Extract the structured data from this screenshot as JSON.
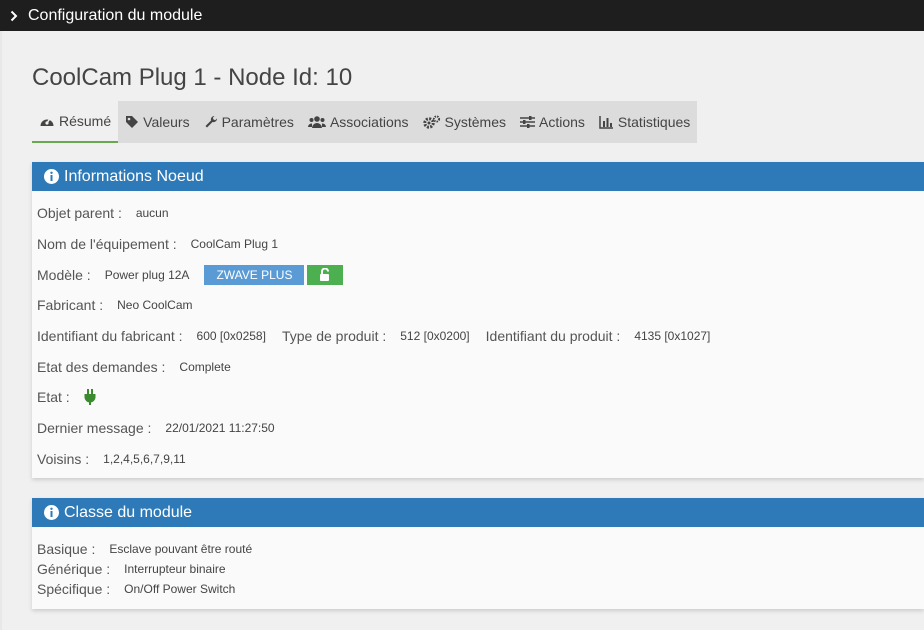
{
  "topbar": {
    "title": "Configuration du module"
  },
  "page": {
    "title": "CoolCam Plug 1 - Node Id: 10"
  },
  "tabs": [
    {
      "label": "Résumé",
      "icon": "dashboard-icon"
    },
    {
      "label": "Valeurs",
      "icon": "tag-icon"
    },
    {
      "label": "Paramètres",
      "icon": "wrench-icon"
    },
    {
      "label": "Associations",
      "icon": "users-icon"
    },
    {
      "label": "Systèmes",
      "icon": "cogs-icon"
    },
    {
      "label": "Actions",
      "icon": "sliders-icon"
    },
    {
      "label": "Statistiques",
      "icon": "bar-chart-icon"
    }
  ],
  "info": {
    "header": "Informations Noeud",
    "parent_label": "Objet parent :",
    "parent_value": "aucun",
    "name_label": "Nom de l'équipement :",
    "name_value": "CoolCam Plug 1",
    "model_label": "Modèle :",
    "model_value": "Power plug 12A",
    "zwave_badge": "ZWAVE PLUS",
    "manufacturer_label": "Fabricant :",
    "manufacturer_value": "Neo CoolCam",
    "manuf_id_label": "Identifiant du fabricant :",
    "manuf_id_value": "600 [0x0258]",
    "product_type_label": "Type de produit :",
    "product_type_value": "512 [0x0200]",
    "product_id_label": "Identifiant du produit :",
    "product_id_value": "4135 [0x1027]",
    "query_label": "Etat des demandes :",
    "query_value": "Complete",
    "state_label": "Etat :",
    "last_msg_label": "Dernier message :",
    "last_msg_value": "22/01/2021 11:27:50",
    "neighbors_label": "Voisins :",
    "neighbors_value": "1,2,4,5,6,7,9,11"
  },
  "class": {
    "header": "Classe du module",
    "basic_label": "Basique :",
    "basic_value": "Esclave pouvant être routé",
    "generic_label": "Générique :",
    "generic_value": "Interrupteur binaire",
    "specific_label": "Spécifique :",
    "specific_value": "On/Off Power Switch"
  },
  "colors": {
    "header_blue": "#2e7ab8",
    "zwave_blue": "#5b9bd5",
    "lock_green": "#4caf50",
    "plug_green": "#3a8a2e",
    "topbar": "#1e1e1e",
    "active_tab_border": "#6aa84f"
  }
}
